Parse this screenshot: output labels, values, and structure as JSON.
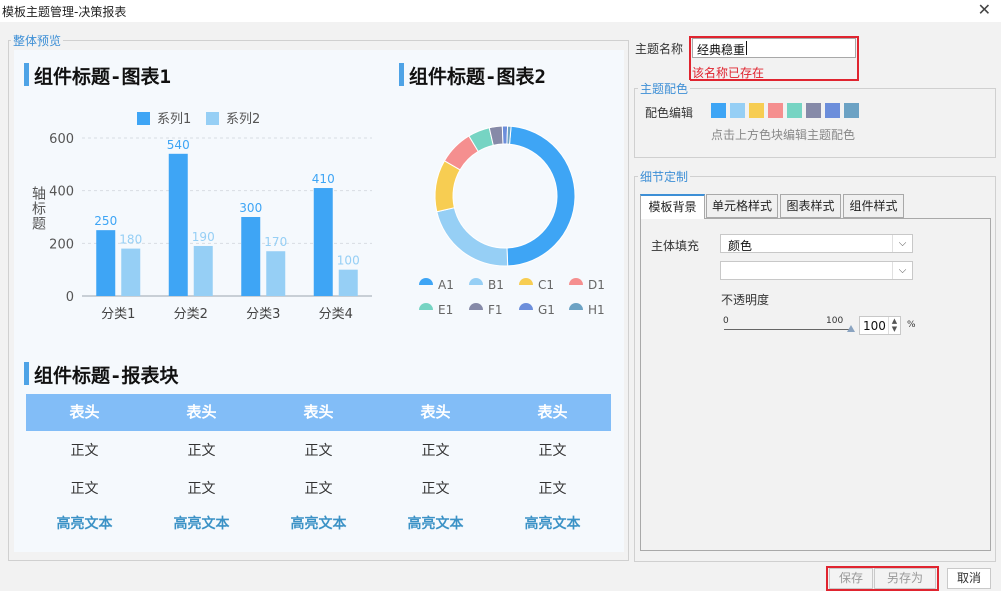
{
  "window": {
    "title": "模板主题管理-决策报表",
    "close_glyph": "✕"
  },
  "preview": {
    "legend": "整体预览",
    "chart1_title": "组件标题-图表1",
    "chart2_title": "组件标题-图表2",
    "block_title": "组件标题-报表块",
    "table": {
      "headers": [
        "表头",
        "表头",
        "表头",
        "表头",
        "表头"
      ],
      "rows": [
        [
          "正文",
          "正文",
          "正文",
          "正文",
          "正文"
        ],
        [
          "正文",
          "正文",
          "正文",
          "正文",
          "正文"
        ]
      ],
      "highlight_row": [
        "高亮文本",
        "高亮文本",
        "高亮文本",
        "高亮文本",
        "高亮文本"
      ]
    }
  },
  "chart_data": [
    {
      "type": "bar",
      "title": "组件标题-图表1",
      "categories": [
        "分类1",
        "分类2",
        "分类3",
        "分类4"
      ],
      "series": [
        {
          "name": "系列1",
          "values": [
            250,
            540,
            300,
            410
          ],
          "color": "#3ea5f5"
        },
        {
          "name": "系列2",
          "values": [
            180,
            190,
            170,
            100
          ],
          "color": "#96cff5"
        }
      ],
      "ylabel": "轴标题",
      "ylim": [
        0,
        600
      ],
      "yticks": [
        0,
        200,
        400,
        600
      ],
      "legend": "top"
    },
    {
      "type": "pie",
      "title": "组件标题-图表2",
      "donut": true,
      "labels": [
        "A1",
        "B1",
        "C1",
        "D1",
        "E1",
        "F1",
        "G1",
        "H1"
      ],
      "values": [
        48,
        22,
        12,
        8,
        5,
        3,
        1.2,
        0.8
      ],
      "colors": [
        "#3ea5f5",
        "#96cff5",
        "#f7cd52",
        "#f58f8f",
        "#76d4c3",
        "#868aa8",
        "#6c8edb",
        "#6ca2c4"
      ],
      "legend": "bottom"
    }
  ],
  "sidebar": {
    "theme_name_label": "主题名称",
    "theme_name_value": "经典稳重",
    "error_text": "该名称已存在",
    "color_group_legend": "主题配色",
    "color_edit_label": "配色编辑",
    "palette": [
      "#3ea5f5",
      "#96cff5",
      "#f7cd52",
      "#f58f8f",
      "#76d4c3",
      "#868aa8",
      "#6c8edb",
      "#6ca2c4"
    ],
    "palette_hint": "点击上方色块编辑主题配色",
    "detail_legend": "细节定制",
    "tabs": [
      "模板背景",
      "单元格样式",
      "图表样式",
      "组件样式"
    ],
    "fill_label": "主体填充",
    "fill_select_value": "颜色",
    "opacity_label": "不透明度",
    "slider_min": "0",
    "slider_max": "100",
    "opacity_value": "100",
    "percent_sign": "%"
  },
  "footer": {
    "save": "保存",
    "save_as": "另存为",
    "cancel": "取消"
  }
}
